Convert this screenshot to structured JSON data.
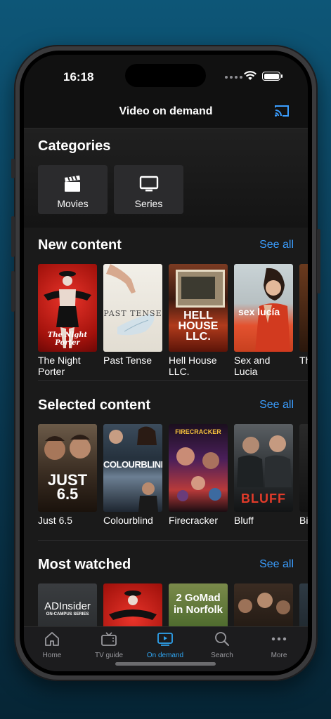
{
  "status_bar": {
    "time": "16:18"
  },
  "header": {
    "title": "Video on demand",
    "cast_icon": "cast-icon"
  },
  "categories": {
    "heading": "Categories",
    "items": [
      {
        "label": "Movies",
        "icon": "clapperboard-icon"
      },
      {
        "label": "Series",
        "icon": "tv-monitor-icon"
      }
    ]
  },
  "new_content": {
    "heading": "New content",
    "see_all": "See all",
    "items": [
      {
        "title": "The Night Porter",
        "poster_text": "The Night Porter"
      },
      {
        "title": "Past Tense",
        "poster_text": "PAST TENSE"
      },
      {
        "title": "Hell House LLC.",
        "poster_text": "HELL HOUSE LLC."
      },
      {
        "title": "Sex and Lucia",
        "poster_text": "sex lucía"
      },
      {
        "title": "Th Bl",
        "poster_text": ""
      }
    ]
  },
  "selected_content": {
    "heading": "Selected content",
    "see_all": "See all",
    "items": [
      {
        "title": "Just 6.5",
        "poster_text": "JUST 6.5"
      },
      {
        "title": "Colourblind",
        "poster_text": "COLOURBLIND"
      },
      {
        "title": "Firecracker",
        "poster_text": "FIRECRACKER"
      },
      {
        "title": "Bluff",
        "poster_text": "BLUFF"
      },
      {
        "title": "Bi Pa",
        "poster_text": ""
      }
    ]
  },
  "most_watched": {
    "heading": "Most watched",
    "see_all": "See all",
    "items": [
      {
        "title": "",
        "poster_text": "ADInsider",
        "poster_sub": "ON-CAMPUS SERIES"
      },
      {
        "title": "",
        "poster_text": ""
      },
      {
        "title": "",
        "poster_text": "2 GoMad in Norfolk"
      },
      {
        "title": "",
        "poster_text": ""
      },
      {
        "title": "",
        "poster_text": ""
      }
    ]
  },
  "tab_bar": {
    "items": [
      {
        "label": "Home",
        "icon": "home-icon"
      },
      {
        "label": "TV guide",
        "icon": "tv-icon"
      },
      {
        "label": "On demand",
        "icon": "play-screen-icon",
        "active": true
      },
      {
        "label": "Search",
        "icon": "search-icon"
      },
      {
        "label": "More",
        "icon": "more-dots-icon"
      }
    ]
  },
  "colors": {
    "accent": "#3b9eff",
    "background": "#1a1a1a"
  }
}
